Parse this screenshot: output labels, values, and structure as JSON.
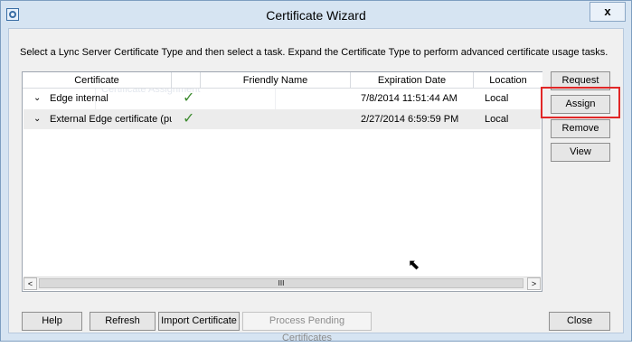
{
  "window": {
    "title": "Certificate Wizard",
    "close_label": "x"
  },
  "instructions": "Select a Lync Server Certificate Type and then select a task. Expand the Certificate Type to perform advanced certificate usage tasks.",
  "background_ghost": "Certificate Assignment",
  "table": {
    "columns": [
      "Certificate",
      "",
      "Friendly Name",
      "Expiration Date",
      "Location"
    ],
    "rows": [
      {
        "certificate": "Edge internal",
        "status_icon": "check-icon",
        "friendly_name": "",
        "expiration": "7/8/2014 11:51:44 AM",
        "location": "Local"
      },
      {
        "certificate": "External Edge certificate (pu",
        "status_icon": "check-icon",
        "friendly_name": "",
        "expiration": "2/27/2014 6:59:59 PM",
        "location": "Local"
      }
    ],
    "scroll_thumb_label": "III"
  },
  "side_buttons": {
    "request": "Request",
    "assign": "Assign",
    "remove": "Remove",
    "view": "View"
  },
  "bottom_buttons": {
    "help": "Help",
    "refresh": "Refresh",
    "import": "Import Certificate",
    "process_pending": "Process Pending Certificates",
    "close": "Close"
  },
  "colors": {
    "accent_highlight": "#e12727",
    "check": "#3d8b2f"
  }
}
